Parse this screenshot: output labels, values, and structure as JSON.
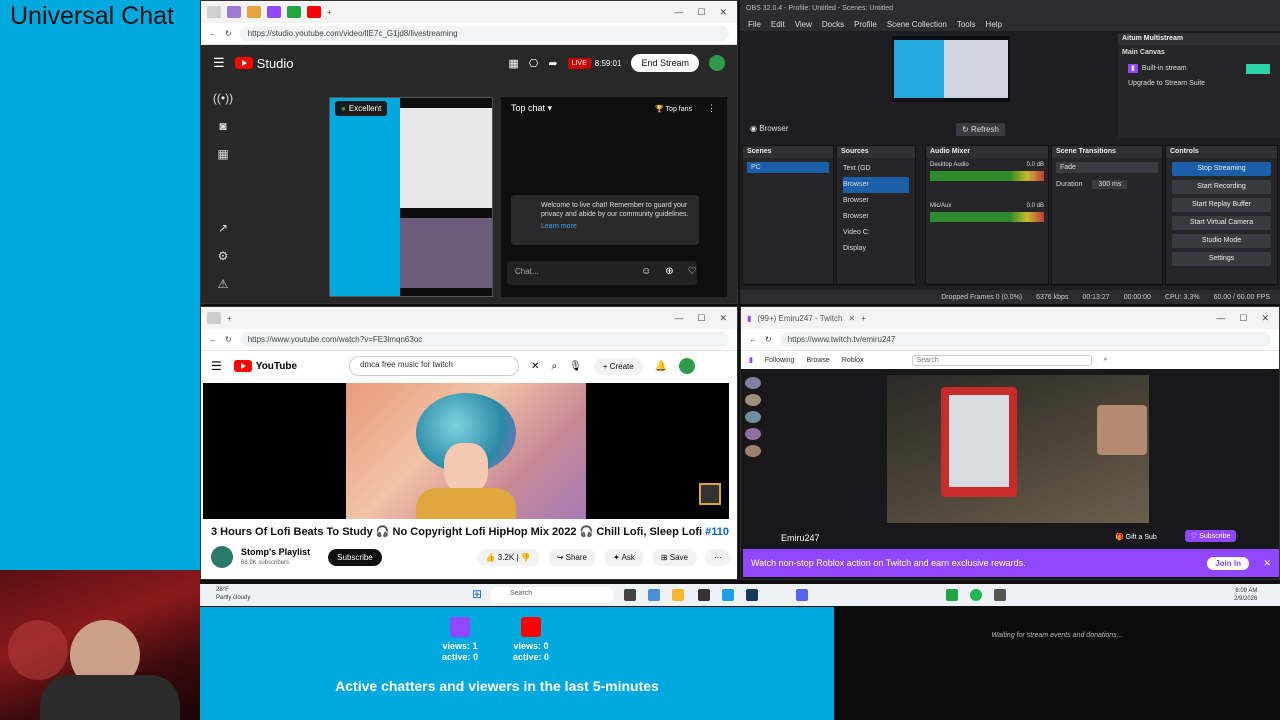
{
  "overlay": {
    "title": "Universal Chat"
  },
  "studio_window": {
    "url": "https://studio.youtube.com/video/lIE7c_G1jd8/livestreaming",
    "app_name": "Studio",
    "live_badge": "LIVE",
    "live_time": "8:59:01",
    "end_stream": "End Stream",
    "quality": "Excellent",
    "chat_mode": "Top chat",
    "top_fans": "Top fans",
    "welcome_text": "Welcome to live chat! Remember to guard your privacy and abide by our community guidelines.",
    "learn_more": "Learn more",
    "chat_placeholder": "Chat..."
  },
  "obs_window": {
    "title": "OBS 32.0.4 - Profile: Untitled - Scenes: Untitled",
    "menu": [
      "File",
      "Edit",
      "View",
      "Docks",
      "Profile",
      "Scene Collection",
      "Tools",
      "Help"
    ],
    "preview_label": "Browser",
    "refresh": "Refresh",
    "multistream": {
      "header": "Aitum Multistream",
      "canvas": "Main Canvas",
      "built_in": "Built-in stream",
      "upgrade": "Upgrade to Stream Suite"
    },
    "docks": {
      "scenes": {
        "title": "Scenes",
        "items": [
          "PC"
        ]
      },
      "sources": {
        "title": "Sources",
        "items": [
          "Text (GD",
          "Browser",
          "Browser",
          "Browser",
          "Video C:",
          "Display"
        ]
      },
      "audio": {
        "title": "Audio Mixer",
        "channels": [
          "Desktop Audio",
          "Mic/Aux"
        ],
        "levels": [
          "0.0 dB",
          "0.0 dB"
        ]
      },
      "transitions": {
        "title": "Scene Transitions",
        "type": "Fade",
        "duration_label": "Duration",
        "duration": "300 ms"
      },
      "controls": {
        "title": "Controls",
        "buttons": [
          "Stop Streaming",
          "Start Recording",
          "Start Replay Buffer",
          "Start Virtual Camera",
          "Studio Mode",
          "Settings"
        ]
      }
    },
    "status": {
      "dropped": "Dropped Frames 0 (0.0%)",
      "bitrate": "6376 kbps",
      "time": "00:13:27",
      "rec_time": "00:00:00",
      "cpu": "CPU: 3.3%",
      "fps": "60.00 / 60.00 FPS"
    }
  },
  "youtube_window": {
    "url": "https://www.youtube.com/watch?v=FE3lmqn63oc",
    "logo": "YouTube",
    "search_value": "dmca free music for twitch",
    "create": "Create",
    "video_title": "3 Hours Of Lofi Beats To Study 🎧 No Copyright Lofi HipHop Mix 2022 🎧 Chill Lofi, Sleep Lofi",
    "video_tag": "#110",
    "channel": "Stomp's Playlist",
    "subscribers": "68.9K subscribers",
    "subscribe": "Subscribe",
    "likes": "3.2K",
    "share": "Share",
    "ask": "Ask",
    "save": "Save"
  },
  "twitch_window": {
    "tab_title": "(99+) Emiru247 - Twitch",
    "url": "https://www.twitch.tv/emiru247",
    "nav": [
      "Following",
      "Browse",
      "Roblox"
    ],
    "search_placeholder": "Search",
    "streamer": "Emiru247",
    "gift": "Gift a Sub",
    "subscribe": "Subscribe",
    "promo": "Watch non-stop Roblox action on Twitch and earn exclusive rewards.",
    "join": "Join In"
  },
  "taskbar": {
    "weather_temp": "28°F",
    "weather_desc": "Partly cloudy",
    "search": "Search",
    "time": "6:09 AM",
    "date": "2/9/2026"
  },
  "stats": {
    "twitch": {
      "views": "views: 1",
      "active": "active: 0"
    },
    "youtube": {
      "views": "views: 0",
      "active": "active: 0"
    },
    "caption": "Active chatters and viewers in the last 5-minutes",
    "colors": {
      "twitch": "#9147ff",
      "youtube": "#ff0000"
    }
  },
  "donations": {
    "message": "Waiting for stream events and donations..."
  }
}
